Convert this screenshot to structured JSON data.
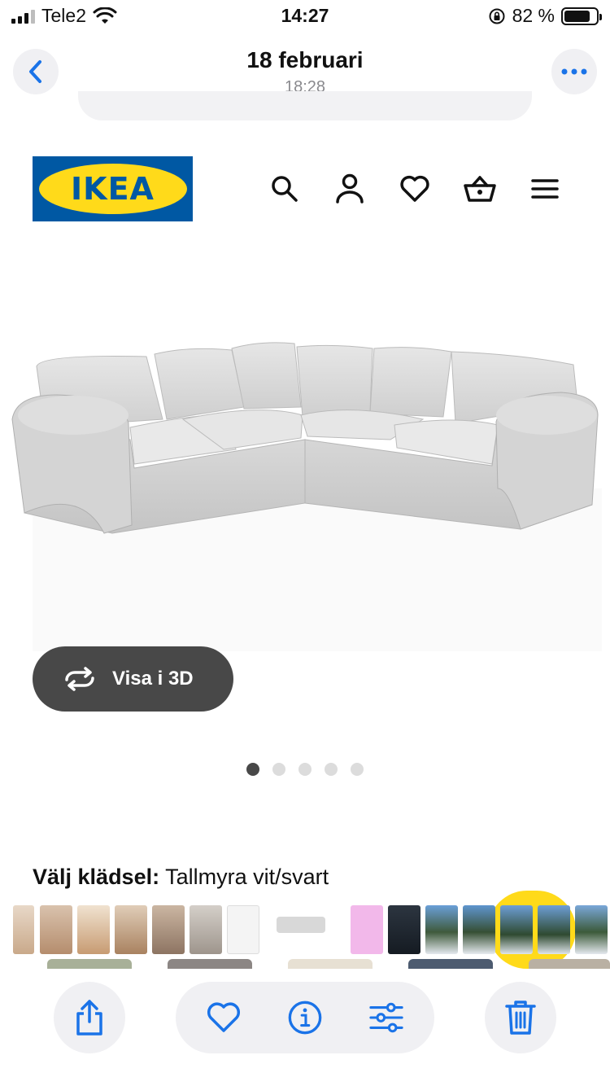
{
  "status_bar": {
    "carrier": "Tele2",
    "time": "14:27",
    "battery": "82 %",
    "battery_level": 0.82
  },
  "viewer": {
    "date": "18 februari",
    "time": "18:28",
    "back_icon": "chevron-left-icon",
    "more_icon": "ellipsis-icon"
  },
  "ikea": {
    "logo_text": "IKEA",
    "brand_blue": "#0058a3",
    "brand_yellow": "#ffda1a",
    "nav_icons": [
      "search-icon",
      "user-icon",
      "heart-icon",
      "basket-icon",
      "menu-icon"
    ]
  },
  "product": {
    "view_3d_label": "Visa i 3D",
    "carousel_total": 5,
    "carousel_active": 1,
    "upholstery_label": "Välj klädsel:",
    "upholstery_value": "Tallmyra vit/svart"
  },
  "toolbar": {
    "icons": [
      "share-icon",
      "heart-icon",
      "info-icon",
      "adjust-icon",
      "trash-icon"
    ],
    "accent": "#1a73e8"
  }
}
